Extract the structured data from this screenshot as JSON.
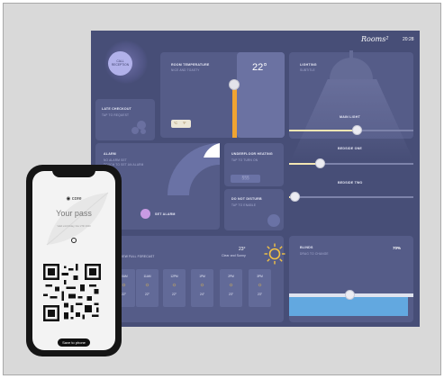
{
  "dashboard": {
    "logo": "Rooms²",
    "time": "20:28",
    "call_reception": "CALL RECEPTION",
    "room_temperature": {
      "title": "ROOM TEMPERATURE",
      "subtitle": "NICE AND TOASTY",
      "value": "22°",
      "buttons": [
        "°C",
        "°F"
      ]
    },
    "late_checkout": {
      "title": "LATE CHECKOUT",
      "subtitle": "TAP TO REQUEST"
    },
    "lighting": {
      "title": "LIGHTING",
      "subtitle": "SUBTITLE",
      "controls": [
        {
          "label": "MAIN LIGHT",
          "level": 0.55
        },
        {
          "label": "BEDSIDE ONE",
          "level": 0.25
        },
        {
          "label": "BEDSIDE TWO",
          "level": 0.05
        }
      ]
    },
    "alarm": {
      "title": "ALARM",
      "subtitle": "NO ALARM SET",
      "subtitle2": "TOUCH TO SET AN ALARM",
      "set_label": "SET ALARM"
    },
    "underfloor_heating": {
      "title": "UNDERFLOOR HEATING",
      "subtitle": "TAP TO TURN ON"
    },
    "do_not_disturb": {
      "title": "DO NOT DISTURB",
      "subtitle": "TAP TO ENABLE"
    },
    "weather": {
      "link": "VIEW FULL FORECAST",
      "current_temp": "23°",
      "condition": "Clear and Sunny",
      "hours": [
        {
          "time": "10AM",
          "temp": "22°"
        },
        {
          "time": "11AM",
          "temp": "22°"
        },
        {
          "time": "12PM",
          "temp": "22°"
        },
        {
          "time": "1PM",
          "temp": "24°"
        },
        {
          "time": "2PM",
          "temp": "23°"
        },
        {
          "time": "3PM",
          "temp": "23°"
        }
      ]
    },
    "blinds": {
      "title": "BLINDS",
      "subtitle": "DRAG TO CHANGE",
      "value": "70%"
    }
  },
  "phone": {
    "brand": "core",
    "title": "Your pass",
    "note": "Valid until Friday, Nov 27th 2020",
    "save_button": "Save to phone"
  },
  "colors": {
    "background": "#474e77",
    "panel": "#555c88",
    "accent_orange": "#f0a431",
    "accent_blue": "#62a8e0",
    "sun": "#f3c244"
  },
  "icons": [
    "bell-icon",
    "moon-icon",
    "sun-icon",
    "qr-code-icon",
    "leaf-icon"
  ]
}
